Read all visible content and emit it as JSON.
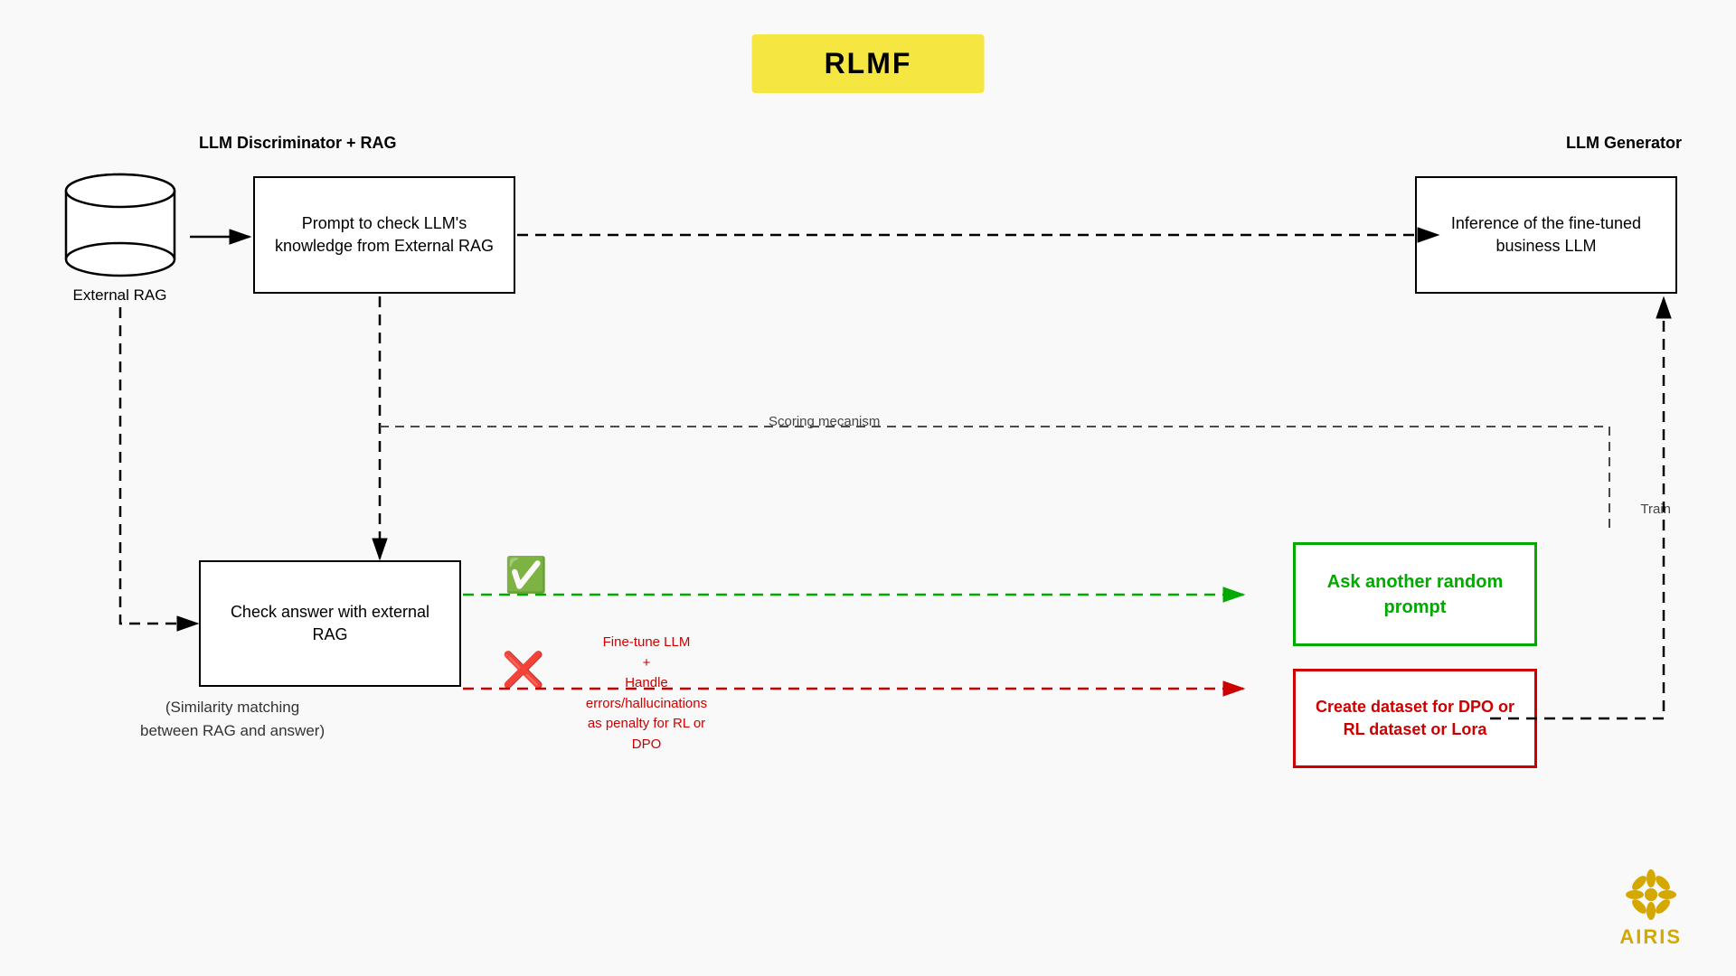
{
  "title": "RLMF",
  "sections": {
    "left_label": "LLM Discriminator + RAG",
    "right_label": "LLM Generator"
  },
  "nodes": {
    "external_rag": "External RAG",
    "prompt_check": "Prompt to check LLM's knowledge from External RAG",
    "inference": "Inference of the fine-tuned business LLM",
    "check_answer": "Check answer with external RAG",
    "ask_random": "Ask another random prompt",
    "create_dataset": "Create dataset for DPO or RL dataset or Lora"
  },
  "labels": {
    "scoring": "Scoring mecanism",
    "train": "Train",
    "similarity_note": "(Similarity matching\nbetween RAG and answer)",
    "finetune": "Fine-tune LLM\n+\nHandle\nerrors/hallucinations\nas penalty for RL or\nDPO"
  },
  "icons": {
    "checkmark": "✅",
    "crossmark": "❌"
  },
  "colors": {
    "title_bg": "#f5e642",
    "green": "#00aa00",
    "red": "#cc0000",
    "black": "#000000",
    "airis_gold": "#d4a800"
  }
}
